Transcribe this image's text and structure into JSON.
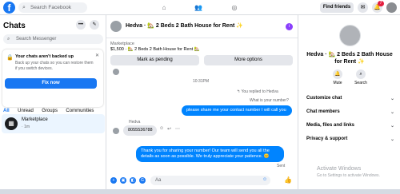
{
  "topbar": {
    "search_placeholder": "Search Facebook",
    "find_friends": "Find friends",
    "notif_count": "7"
  },
  "left": {
    "title": "Chats",
    "search_placeholder": "Search Messenger",
    "backup_title": "Your chats aren't backed up",
    "backup_desc": "Back up your chats so you can restore them if you switch devices.",
    "fix_now": "Fix now",
    "filters": [
      "All",
      "Unread",
      "Groups",
      "Communities"
    ],
    "conversation": {
      "name": "Marketplace",
      "time": "· 1m"
    }
  },
  "chat": {
    "title": "Hedva · 🏡 2 Beds 2 Bath House for Rent ✨",
    "listing_label": "Marketplace",
    "listing_price": "$1,500 · 🏡 2 Beds 2 Bath House for Rent 🏡",
    "mark_pending": "Mark as pending",
    "more_options": "More options",
    "timestamp": "10:31PM",
    "replied_to": "↰ You replied to Hedva",
    "quoted": "What is your number?",
    "out_msg1": "please share me your contact number I will call you",
    "sender_name": "Hedva",
    "in_msg": "8055536788",
    "out_msg2": "Thank you for sharing your number!   Our team will send you all the details as soon as possible. We truly appreciate your patience. 😊",
    "sent": "Sent",
    "compose_placeholder": "Aa"
  },
  "right": {
    "name": "Hedva · 🏡 2 Beds 2 Bath House for Rent ✨",
    "mute": "Mute",
    "search": "Search",
    "rows": [
      "Customize chat",
      "Chat members",
      "Media, files and links",
      "Privacy & support"
    ]
  },
  "watermark": {
    "line1": "Activate Windows",
    "line2": "Go to Settings to activate Windows."
  }
}
